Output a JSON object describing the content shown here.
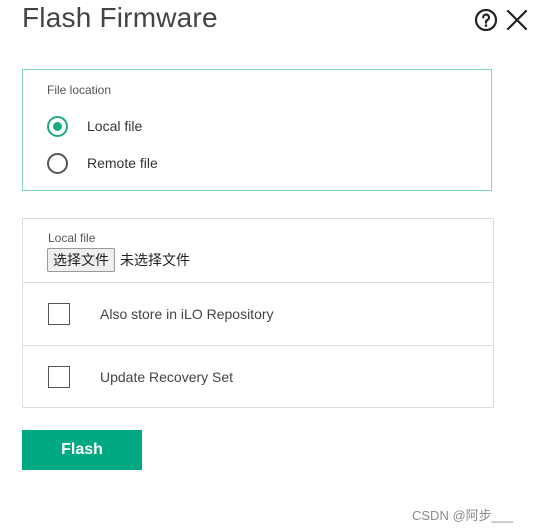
{
  "dialog": {
    "title": "Flash Firmware"
  },
  "header": {
    "help_icon": "question-circle-icon",
    "close_icon": "close-icon"
  },
  "file_location": {
    "label": "File location",
    "options": [
      {
        "label": "Local file",
        "checked": true
      },
      {
        "label": "Remote file",
        "checked": false
      }
    ]
  },
  "local_file": {
    "label": "Local file",
    "choose_button": "选择文件",
    "no_file_text": "未选择文件"
  },
  "options": [
    {
      "label": "Also store in iLO Repository",
      "checked": false
    },
    {
      "label": "Update Recovery Set",
      "checked": false
    }
  ],
  "actions": {
    "flash_label": "Flash"
  },
  "watermark": "CSDN @阿步___",
  "colors": {
    "accent": "#01a982",
    "panel_border": "#7fd6c9",
    "radio_checked": "#1fa97f"
  }
}
